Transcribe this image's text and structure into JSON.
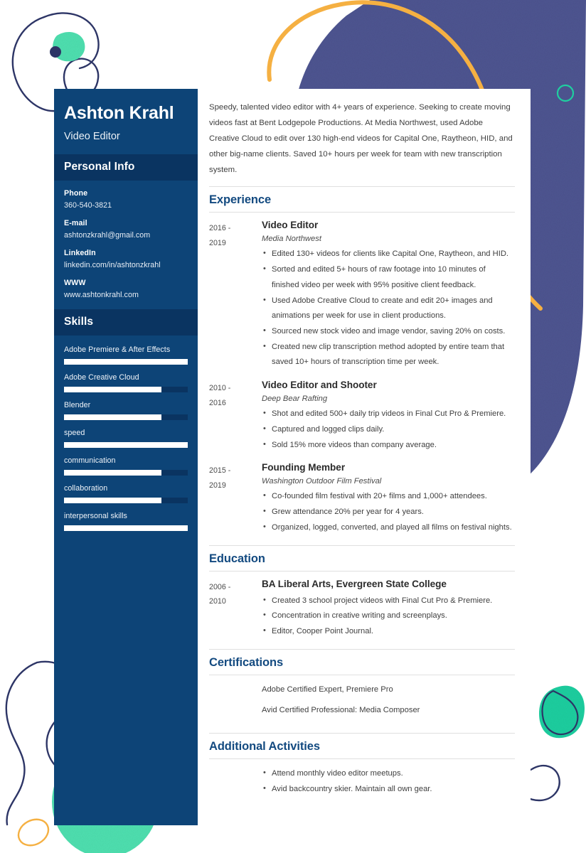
{
  "colors": {
    "sidebar_bg": "#0d4477",
    "sidebar_band": "#0a3461",
    "heading_blue": "#134a80",
    "accent_navy": "#2d3566",
    "accent_mint": "#4fe0b0",
    "accent_teal": "#1fcfa0",
    "accent_amber": "#f5b042",
    "blob_slate": "#4e5591",
    "body_text": "#3f3f3f",
    "rule": "#e0e0e0"
  },
  "sidebar": {
    "name": "Ashton Krahl",
    "job_title": "Video Editor",
    "personal_info_heading": "Personal Info",
    "contacts": [
      {
        "label": "Phone",
        "value": "360-540-3821"
      },
      {
        "label": "E-mail",
        "value": "ashtonzkrahl@gmail.com"
      },
      {
        "label": "LinkedIn",
        "value": "linkedin.com/in/ashtonzkrahl"
      },
      {
        "label": "WWW",
        "value": "www.ashtonkrahl.com"
      }
    ],
    "skills_heading": "Skills",
    "skills": [
      {
        "label": "Adobe Premiere & After Effects",
        "level": 100
      },
      {
        "label": "Adobe Creative Cloud",
        "level": 79
      },
      {
        "label": "Blender",
        "level": 79
      },
      {
        "label": "speed",
        "level": 100
      },
      {
        "label": "communication",
        "level": 79
      },
      {
        "label": "collaboration",
        "level": 79
      },
      {
        "label": "interpersonal skills",
        "level": 100
      }
    ]
  },
  "main": {
    "summary": "Speedy, talented video editor with 4+ years of experience. Seeking to create moving videos fast at Bent Lodgepole Productions. At Media Northwest, used Adobe Creative Cloud to edit over 130 high-end videos for Capital One, Raytheon, HID, and other big-name clients. Saved 10+ hours per week for team with new transcription system.",
    "sections": [
      {
        "title": "Experience",
        "entries": [
          {
            "dates": "2016 - 2019",
            "role": "Video Editor",
            "org": "Media Northwest",
            "bullets": [
              "Edited 130+ videos for clients like Capital One, Raytheon, and HID.",
              "Sorted and edited 5+ hours of raw footage into 10 minutes of finished video per week with 95% positive client feedback.",
              "Used Adobe Creative Cloud to create and edit 20+ images and animations per week for use in client productions.",
              "Sourced new stock video and image vendor, saving 20% on costs.",
              "Created new clip transcription method adopted by entire team that saved 10+ hours of transcription time per week."
            ]
          },
          {
            "dates": "2010 - 2016",
            "role": "Video Editor and Shooter",
            "org": "Deep Bear Rafting",
            "bullets": [
              "Shot and edited 500+ daily trip videos in Final Cut Pro & Premiere.",
              "Captured and logged clips daily.",
              "Sold 15% more videos than company average."
            ]
          },
          {
            "dates": "2015 - 2019",
            "role": "Founding Member",
            "org": "Washington Outdoor Film Festival",
            "bullets": [
              "Co-founded film festival with 20+ films and 1,000+ attendees.",
              "Grew attendance 20% per year for 4 years.",
              "Organized, logged, converted, and played all films on festival nights."
            ]
          }
        ]
      },
      {
        "title": "Education",
        "entries": [
          {
            "dates": "2006 - 2010",
            "role": "BA Liberal Arts, Evergreen State College",
            "org": "",
            "bullets": [
              "Created 3 school project videos with Final Cut Pro & Premiere.",
              "Concentration in creative writing and screenplays.",
              "Editor, Cooper Point Journal."
            ]
          }
        ]
      },
      {
        "title": "Certifications",
        "entries": [
          {
            "dates": "",
            "role": "",
            "org": "",
            "lines": [
              "Adobe Certified Expert, Premiere Pro",
              "Avid Certified Professional: Media Composer"
            ]
          }
        ]
      },
      {
        "title": "Additional Activities",
        "entries": [
          {
            "dates": "",
            "role": "",
            "org": "",
            "bullets": [
              "Attend monthly video editor meetups.",
              "Avid backcountry skier. Maintain all own gear."
            ]
          }
        ]
      }
    ]
  }
}
